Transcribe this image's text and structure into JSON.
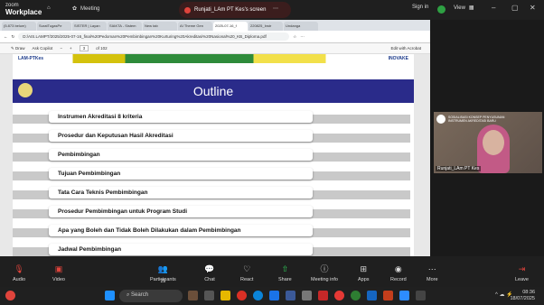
{
  "zoom": {
    "logo_top": "zoom",
    "logo_bottom": "Workplace",
    "home_label": "Home",
    "meeting_label": "Meeting",
    "share_title": "Runjati_LAm PT Kes's screen",
    "signin": "Sign in",
    "view": "View"
  },
  "browser": {
    "tabs": [
      "(5.873 belum)",
      "SuratTugasPe",
      "SISTER | Layan",
      "SIAKTA - Sistem",
      "New tab",
      "AI Theme Gen",
      "2025-07-16_f",
      "220825_Instr",
      "Undanga"
    ],
    "url": "D:/AIS.LAMPT/2025/2025-07-16_final%20Pedoman%20Pembimbingan%20Kurturing%20Akreditasi%20Nasional%20_KB_Diploma.pdf",
    "draw": "Draw",
    "ask_copilot": "Ask Copilot",
    "page": "3",
    "page_total": "of 102",
    "zoom_in": "+",
    "edit_acrobat": "Edit with Acrobat"
  },
  "slide": {
    "strip_left": "LAM-PTKes",
    "strip_right": "INOVAKE",
    "title": "Outline",
    "items": [
      "Instrumen Akreditasi 8 kriteria",
      "Prosedur dan Keputusan Hasil Akreditasi",
      "Pembimbingan",
      "Tujuan Pembimbingan",
      "Tata Cara Teknis Pembimbingan",
      "Prosedur Pembimbingan untuk Program Studi",
      "Apa yang Boleh dan Tidak Boleh Dilakukan dalam Pembimbingan",
      "Jadwal Pembimbingan"
    ]
  },
  "video": {
    "banner": "SOSIALISASI KONSEP PENYUSUNAN INSTRUMEN AKREDITASI BARU",
    "name": "Runjati_LAm PT Kes"
  },
  "controls": {
    "audio": "Audio",
    "video": "Video",
    "participants": "Participants",
    "participants_count": "25",
    "chat": "Chat",
    "react": "React",
    "share": "Share",
    "meeting_info": "Meeting info",
    "apps": "Apps",
    "record": "Record",
    "more": "More",
    "leave": "Leave"
  },
  "taskbar": {
    "search": "Search",
    "time": "08:36",
    "date": "18/07/2025"
  }
}
